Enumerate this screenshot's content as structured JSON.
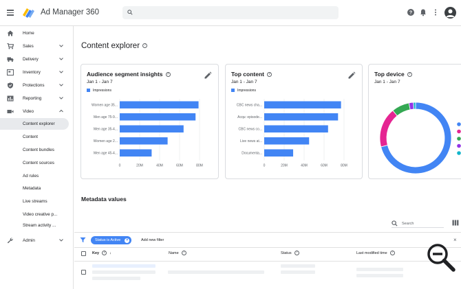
{
  "header": {
    "app_title": "Ad Manager 360",
    "search_placeholder": ""
  },
  "sidebar": {
    "items": [
      {
        "label": "Home",
        "icon": "home-icon"
      },
      {
        "label": "Sales",
        "icon": "cart-icon",
        "expandable": true
      },
      {
        "label": "Delivery",
        "icon": "truck-icon",
        "expandable": true
      },
      {
        "label": "Inventory",
        "icon": "inventory-icon",
        "expandable": true
      },
      {
        "label": "Protections",
        "icon": "shield-icon",
        "expandable": true
      },
      {
        "label": "Reporting",
        "icon": "bar-chart-icon",
        "expandable": true
      },
      {
        "label": "Video",
        "icon": "video-icon",
        "expanded": true
      }
    ],
    "video_sub_items": [
      {
        "label": "Content explorer",
        "active": true
      },
      {
        "label": "Content"
      },
      {
        "label": "Content bundles"
      },
      {
        "label": "Content sources"
      },
      {
        "label": "Ad rules"
      },
      {
        "label": "Metadata"
      },
      {
        "label": "Live streams"
      },
      {
        "label": "Video creative p..."
      },
      {
        "label": "Stream activity ..."
      }
    ],
    "admin": {
      "label": "Admin",
      "icon": "wrench-icon"
    }
  },
  "main": {
    "page_title": "Content explorer",
    "cards": [
      {
        "title": "Audience segment insights",
        "date": "Jan 1 - Jan 7",
        "legend": "Impressions",
        "categories": [
          "Women age 35...",
          "Men age 75-9...",
          "Men age 35-4...",
          "Women age 2...",
          "Men age 45-4..."
        ],
        "values": [
          79,
          76,
          64,
          48,
          32
        ],
        "ticks": [
          "0",
          "20M",
          "40M",
          "60M",
          "80M"
        ]
      },
      {
        "title": "Top content",
        "date": "Jan 1 - Jan 7",
        "legend": "Impressions",
        "categories": [
          "CBC news cha...",
          "Acqu: episode...",
          "CBC news co...",
          "Live news at...",
          "Documenta..."
        ],
        "values": [
          77,
          74,
          64,
          45,
          29
        ],
        "ticks": [
          "0",
          "20M",
          "40M",
          "60M",
          "80M"
        ]
      },
      {
        "title": "Top device",
        "date": "Jan 1 - Jan 7"
      }
    ],
    "metadata_title": "Metadata values",
    "table": {
      "search_placeholder": "Search",
      "filter_chip": "Status is Active",
      "add_filter": "Add new filter",
      "columns": {
        "key": "Key",
        "name": "Name",
        "status": "Status",
        "last_modified": "Last modified time"
      }
    }
  },
  "chart_data": [
    {
      "type": "bar",
      "orientation": "horizontal",
      "title": "Audience segment insights",
      "subtitle": "Jan 1 - Jan 7",
      "categories": [
        "Women age 35...",
        "Men age 75-9...",
        "Men age 35-4...",
        "Women age 2...",
        "Men age 45-4..."
      ],
      "series": [
        {
          "name": "Impressions",
          "values": [
            79,
            76,
            64,
            48,
            32
          ]
        }
      ],
      "value_unit": "M",
      "xlim": [
        0,
        80
      ],
      "tick_labels": [
        "0",
        "20M",
        "40M",
        "60M",
        "80M"
      ],
      "grid": true,
      "legend": "top-left"
    },
    {
      "type": "bar",
      "orientation": "horizontal",
      "title": "Top content",
      "subtitle": "Jan 1 - Jan 7",
      "categories": [
        "CBC news cha...",
        "Acqu: episode...",
        "CBC news co...",
        "Live news at...",
        "Documenta..."
      ],
      "series": [
        {
          "name": "Impressions",
          "values": [
            77,
            74,
            64,
            45,
            29
          ]
        }
      ],
      "value_unit": "M",
      "xlim": [
        0,
        80
      ],
      "tick_labels": [
        "0",
        "20M",
        "40M",
        "60M",
        "80M"
      ],
      "grid": true,
      "legend": "top-left"
    },
    {
      "type": "pie",
      "style": "donut",
      "title": "Top device",
      "subtitle": "Jan 1 - Jan 7",
      "values": [
        71,
        18,
        8,
        2,
        1
      ],
      "colors": [
        "#4285f4",
        "#e52592",
        "#34a853",
        "#9334e6",
        "#12b5cb"
      ],
      "legend": "right"
    }
  ],
  "colors": {
    "accent": "#4285f4",
    "pink": "#e52592",
    "green": "#34a853",
    "purple": "#9334e6",
    "teal": "#12b5cb"
  }
}
